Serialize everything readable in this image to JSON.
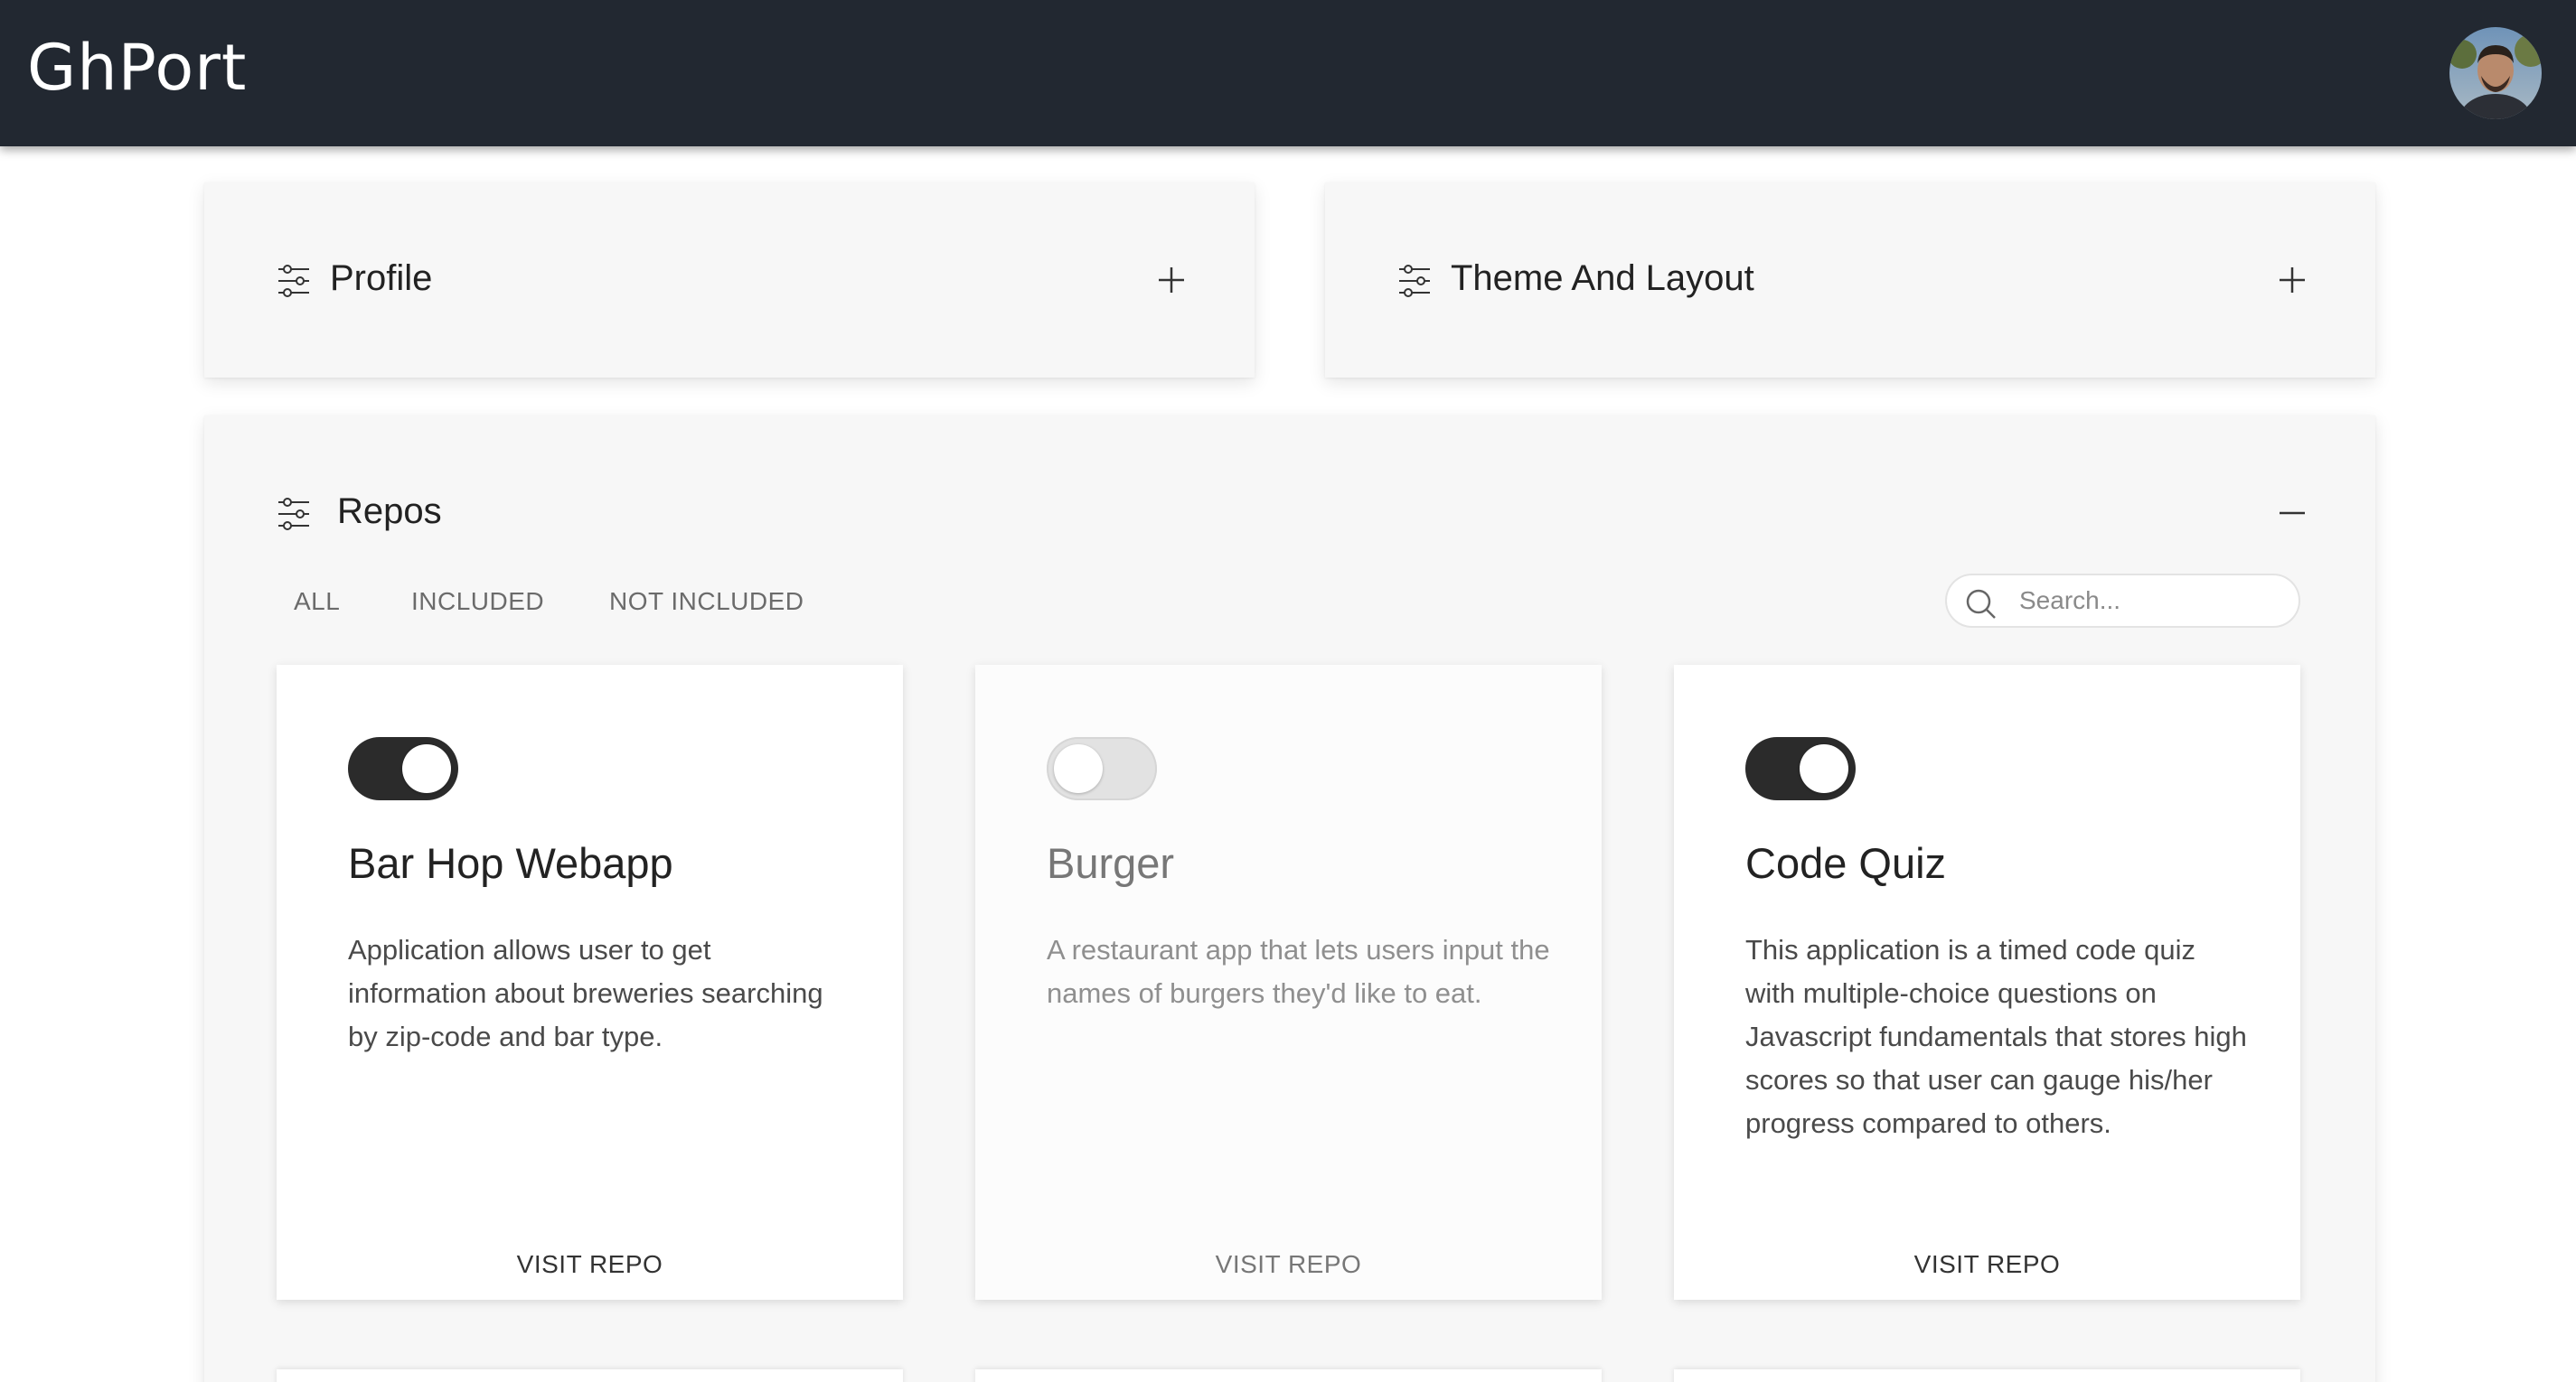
{
  "header": {
    "brand": "GhPort",
    "avatar_icon": "user-avatar"
  },
  "sections": {
    "profile": {
      "title": "Profile",
      "icon": "tune-icon",
      "action_icon": "plus-icon"
    },
    "theme": {
      "title": "Theme And Layout",
      "icon": "tune-icon",
      "action_icon": "plus-icon"
    },
    "repos": {
      "title": "Repos",
      "icon": "tune-icon",
      "action_icon": "minus-icon"
    }
  },
  "filters": [
    "ALL",
    "INCLUDED",
    "NOT INCLUDED"
  ],
  "search": {
    "placeholder": "Search...",
    "value": ""
  },
  "repos": [
    {
      "title": "Bar Hop Webapp",
      "description": "Application allows user to get information about breweries searching by zip-code and bar type.",
      "included": true,
      "link_label": "VISIT REPO"
    },
    {
      "title": "Burger",
      "description": "A restaurant app that lets users input the names of burgers they'd like to eat.",
      "included": false,
      "link_label": "VISIT REPO"
    },
    {
      "title": "Code Quiz",
      "description": "This application is a timed code quiz with multiple-choice questions on Javascript fundamentals that stores high scores so that user can gauge his/her progress compared to others.",
      "included": true,
      "link_label": "VISIT REPO"
    }
  ],
  "colors": {
    "header_bg": "#222831",
    "panel_bg": "#f7f7f7",
    "toggle_on": "#2b2b2b",
    "toggle_off": "#e2e2e2"
  }
}
